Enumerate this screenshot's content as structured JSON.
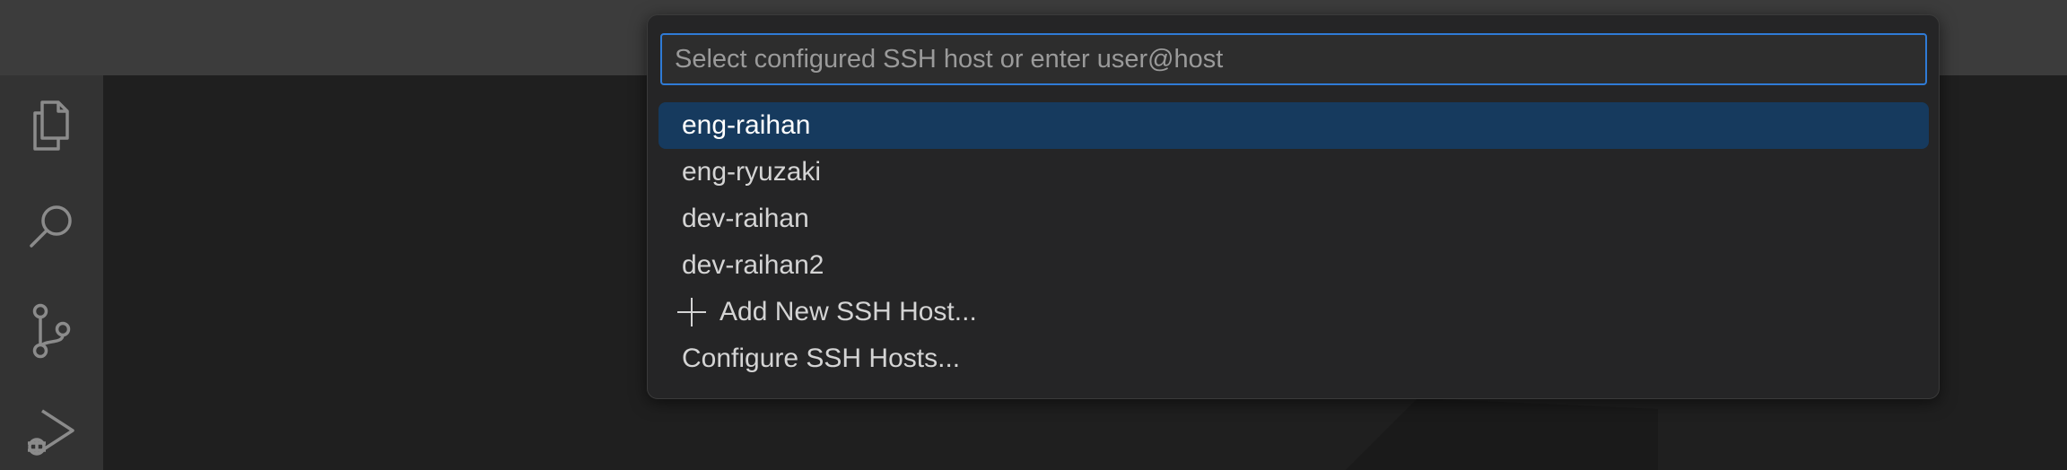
{
  "activity_bar": {
    "icons": [
      "explorer-icon",
      "search-icon",
      "source-control-icon",
      "run-debug-icon"
    ]
  },
  "quick_pick": {
    "placeholder": "Select configured SSH host or enter user@host",
    "value": "",
    "selected_index": 0,
    "items": [
      {
        "label": "eng-raihan"
      },
      {
        "label": "eng-ryuzaki"
      },
      {
        "label": "dev-raihan"
      },
      {
        "label": "dev-raihan2"
      },
      {
        "label": "Add New SSH Host...",
        "icon": "plus-icon"
      },
      {
        "label": "Configure SSH Hosts..."
      }
    ]
  },
  "colors": {
    "accent": "#2f7bd6",
    "selection": "#163a5e",
    "titlebar": "#3c3c3c",
    "activity_bar": "#333333",
    "editor": "#1f1f1f"
  }
}
